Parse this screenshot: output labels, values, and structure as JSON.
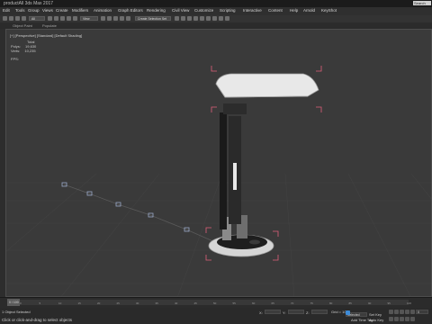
{
  "app": {
    "title": "productAll 3ds Max 2017",
    "search_label": "Search"
  },
  "menus": [
    "Edit",
    "Tools",
    "Group",
    "Views",
    "Create",
    "Modifiers",
    "Animation",
    "Graph Editors",
    "Rendering",
    "Civil View",
    "Customize",
    "Scripting",
    "Interactive",
    "Content",
    "Help",
    "Arnold",
    "KeyShot"
  ],
  "toolbar": {
    "selection_filter": "All",
    "view_dropdown": "View",
    "named_selection": "Create Selection Set"
  },
  "ribbon": {
    "tabs": [
      "Object Paint",
      "Populate"
    ]
  },
  "viewport": {
    "label": "[+] [Perspective] [Standard] [Default Shading]",
    "stats": {
      "total_label": "Total",
      "polys_label": "Polys:",
      "polys_value": "19,630",
      "verts_label": "Verts:",
      "verts_value": "10,235",
      "fps_label": "FPS:"
    }
  },
  "timeline": {
    "frame_label": "0 / 100",
    "ticks": [
      "0",
      "5",
      "10",
      "15",
      "20",
      "25",
      "30",
      "35",
      "40",
      "45",
      "50",
      "55",
      "60",
      "65",
      "70",
      "75",
      "80",
      "85",
      "90",
      "95",
      "100"
    ]
  },
  "status": {
    "selected": "1 Object Selected",
    "prompt": "Click or click-and-drag to select objects",
    "x_label": "X:",
    "y_label": "Y:",
    "z_label": "Z:",
    "grid": "Grid = 10.0",
    "add_time_tag": "Add Time Tag",
    "set_key": "Set Key",
    "key_filters": "Selected",
    "auto_key": "Auto Key",
    "frame": "0"
  },
  "colors": {
    "viewport_bg": "#3a3a3a",
    "selection_bracket": "#e0607a",
    "lamp_body": "#e6e6e6"
  }
}
